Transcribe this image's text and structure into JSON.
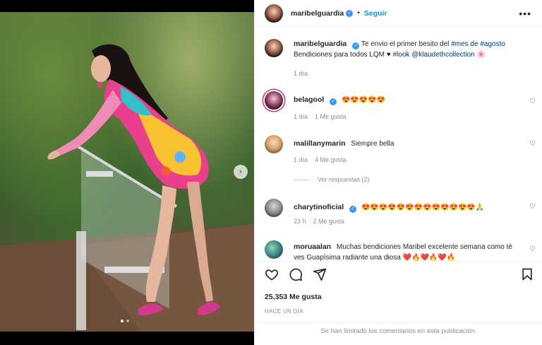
{
  "post": {
    "photo": {
      "slide_index": 1,
      "slide_count": 2
    }
  },
  "header": {
    "username": "maribelguardia",
    "separator": "•",
    "follow_label": "Seguir",
    "more_label": "•••"
  },
  "caption": {
    "username": "maribelguardia",
    "text_before": "Te envio el primer besito del",
    "hashtag1": "#mes",
    "word_de": "de",
    "hashtag2": "#agosto",
    "line2_before": "Bendiciones para todos LQM",
    "heart_emoji": "♥",
    "hashtag3": "#look",
    "mention": "@klaudethcollection",
    "flower_emoji": "🌸",
    "time": "1 día"
  },
  "comments": [
    {
      "username": "belagool",
      "verified": true,
      "text": "😍😍😍😍😍",
      "time": "1 día",
      "likes": "1 Me gusta"
    },
    {
      "username": "malillanymarin",
      "verified": false,
      "text": "Siempre bella",
      "time": "1 día",
      "likes": "4 Me gusta",
      "replies": "Ver respuestas (2)"
    },
    {
      "username": "charytinoficial",
      "verified": true,
      "text": "😍😍😍😍😍😍😍😍😍😍😍😍😍🙏",
      "time": "23 h",
      "likes": "2 Me gusta"
    },
    {
      "username": "moruaalan",
      "verified": false,
      "text": "Muchas bendiciones Maribel excelente semana como té ves Guapísima radiante una diosa ❤️🔥❤️🔥❤️🔥"
    }
  ],
  "actions": {
    "likes": "25,353 Me gusta",
    "time_ago": "HACE UN DÍA",
    "limited_notice": "Se han limitado los comentarios en esta publicación."
  },
  "icons": {
    "like": "heart-outline-icon",
    "comment": "comment-icon",
    "share": "share-icon",
    "save": "bookmark-icon",
    "verified": "verified-badge-icon",
    "more": "more-icon",
    "next": "chevron-right-icon"
  },
  "colors": {
    "link": "#00376b",
    "follow": "#0095f6",
    "verified": "#3897f0"
  }
}
